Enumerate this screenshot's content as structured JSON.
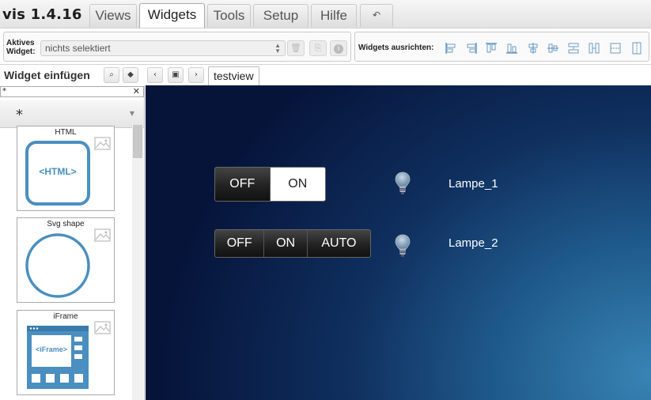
{
  "app": {
    "title": "vis 1.4.16"
  },
  "menu": {
    "tabs": [
      {
        "label": "Views",
        "active": false
      },
      {
        "label": "Widgets",
        "active": true
      },
      {
        "label": "Tools",
        "active": false
      },
      {
        "label": "Setup",
        "active": false
      },
      {
        "label": "Hilfe",
        "active": false
      }
    ],
    "undo_icon": "undo-icon"
  },
  "toolbar": {
    "active_widget_label": "Aktives\nWidget:",
    "active_widget_line1": "Aktives",
    "active_widget_line2": "Widget:",
    "active_widget_value": "nichts selektiert",
    "align_label": "Widgets ausrichten:",
    "align_icons": [
      "align-left-icon",
      "align-right-icon",
      "align-top-icon",
      "align-bottom-icon",
      "center-vertical-icon",
      "center-horizontal-icon",
      "distribute-horizontal-icon",
      "distribute-vertical-icon",
      "same-width-icon",
      "same-height-icon"
    ]
  },
  "subbar": {
    "insert_title": "Widget einfügen",
    "view_tab": "testview"
  },
  "palette": {
    "filter_value": "*",
    "set_value": "*",
    "widgets": [
      {
        "name": "HTML",
        "preview_text": "<HTML>"
      },
      {
        "name": "Svg shape",
        "preview_text": ""
      },
      {
        "name": "iFrame",
        "preview_text": "<iFrame>"
      }
    ]
  },
  "canvas": {
    "switch1": {
      "buttons": [
        "OFF",
        "ON"
      ],
      "selected": "ON"
    },
    "switch2": {
      "buttons": [
        "OFF",
        "ON",
        "AUTO"
      ],
      "selected": ""
    },
    "lamp1": {
      "label": "Lampe_1"
    },
    "lamp2": {
      "label": "Lampe_2"
    }
  },
  "colors": {
    "accent_blue": "#4a8fc0",
    "canvas_dark": "#06143a",
    "canvas_light": "#3884b4"
  }
}
